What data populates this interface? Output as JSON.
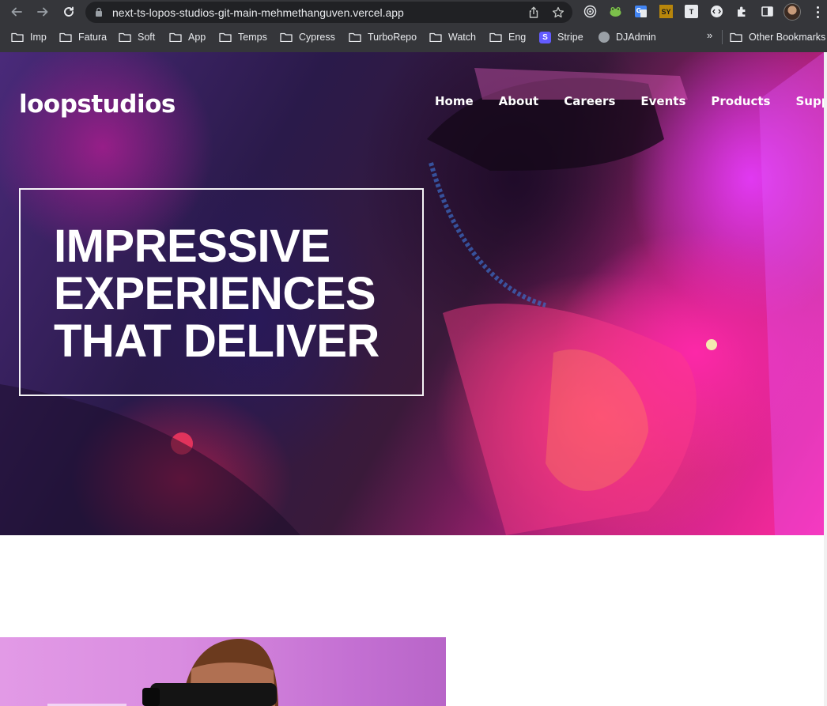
{
  "browser": {
    "url": "next-ts-lopos-studios-git-main-mehmethanguven.vercel.app",
    "bookmarks": [
      "Imp",
      "Fatura",
      "Soft",
      "App",
      "Temps",
      "Cypress",
      "TurboRepo",
      "Watch",
      "Eng",
      "Stripe",
      "DJAdmin"
    ],
    "other_bookmarks": "Other Bookmarks",
    "overflow_chevron": "»",
    "extension_labels": {
      "sy": "SY",
      "t": "T"
    },
    "stripe_letter": "S"
  },
  "site": {
    "logo": "loopstudios",
    "nav": [
      "Home",
      "About",
      "Careers",
      "Events",
      "Products",
      "Support"
    ],
    "hero_title": [
      "IMPRESSIVE",
      "EXPERIENCES",
      "THAT DELIVER"
    ]
  },
  "icons": {
    "back": "arrow-left-icon",
    "forward": "arrow-right-icon",
    "reload": "reload-icon",
    "lock": "lock-icon",
    "share": "share-icon",
    "star": "star-icon",
    "extensions": "puzzle-icon",
    "sidebar": "side-panel-icon",
    "menu": "kebab-menu-icon",
    "folder": "folder-icon"
  },
  "colors": {
    "chrome_bg": "#35363a",
    "omnibox_bg": "#202124",
    "hero_accent_pink": "#ff2aa0",
    "hero_dark": "#2a1a4a"
  }
}
